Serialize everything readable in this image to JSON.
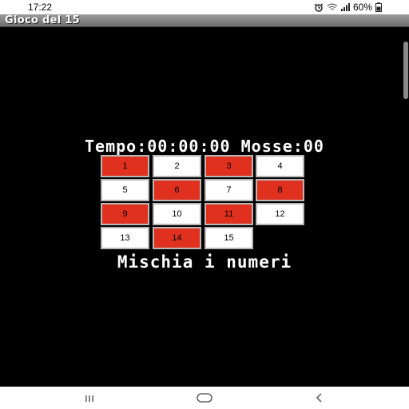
{
  "status": {
    "time": "17:22",
    "battery": "60%",
    "icons": [
      "alarm-icon",
      "wifi-icon",
      "signal-icon",
      "battery-icon"
    ]
  },
  "app": {
    "title": "Gioco del 15"
  },
  "game": {
    "info": "Tempo:00:00:00 Mosse:00",
    "shuffle_label": "Mischia i numeri",
    "tiles": [
      "1",
      "2",
      "3",
      "4",
      "5",
      "6",
      "7",
      "8",
      "9",
      "10",
      "11",
      "12",
      "13",
      "14",
      "15"
    ],
    "tile_colors": {
      "red": "#e0301e",
      "white": "#ffffff"
    }
  },
  "nav": {
    "buttons": [
      "recent-apps-icon",
      "home-icon",
      "back-icon"
    ]
  }
}
